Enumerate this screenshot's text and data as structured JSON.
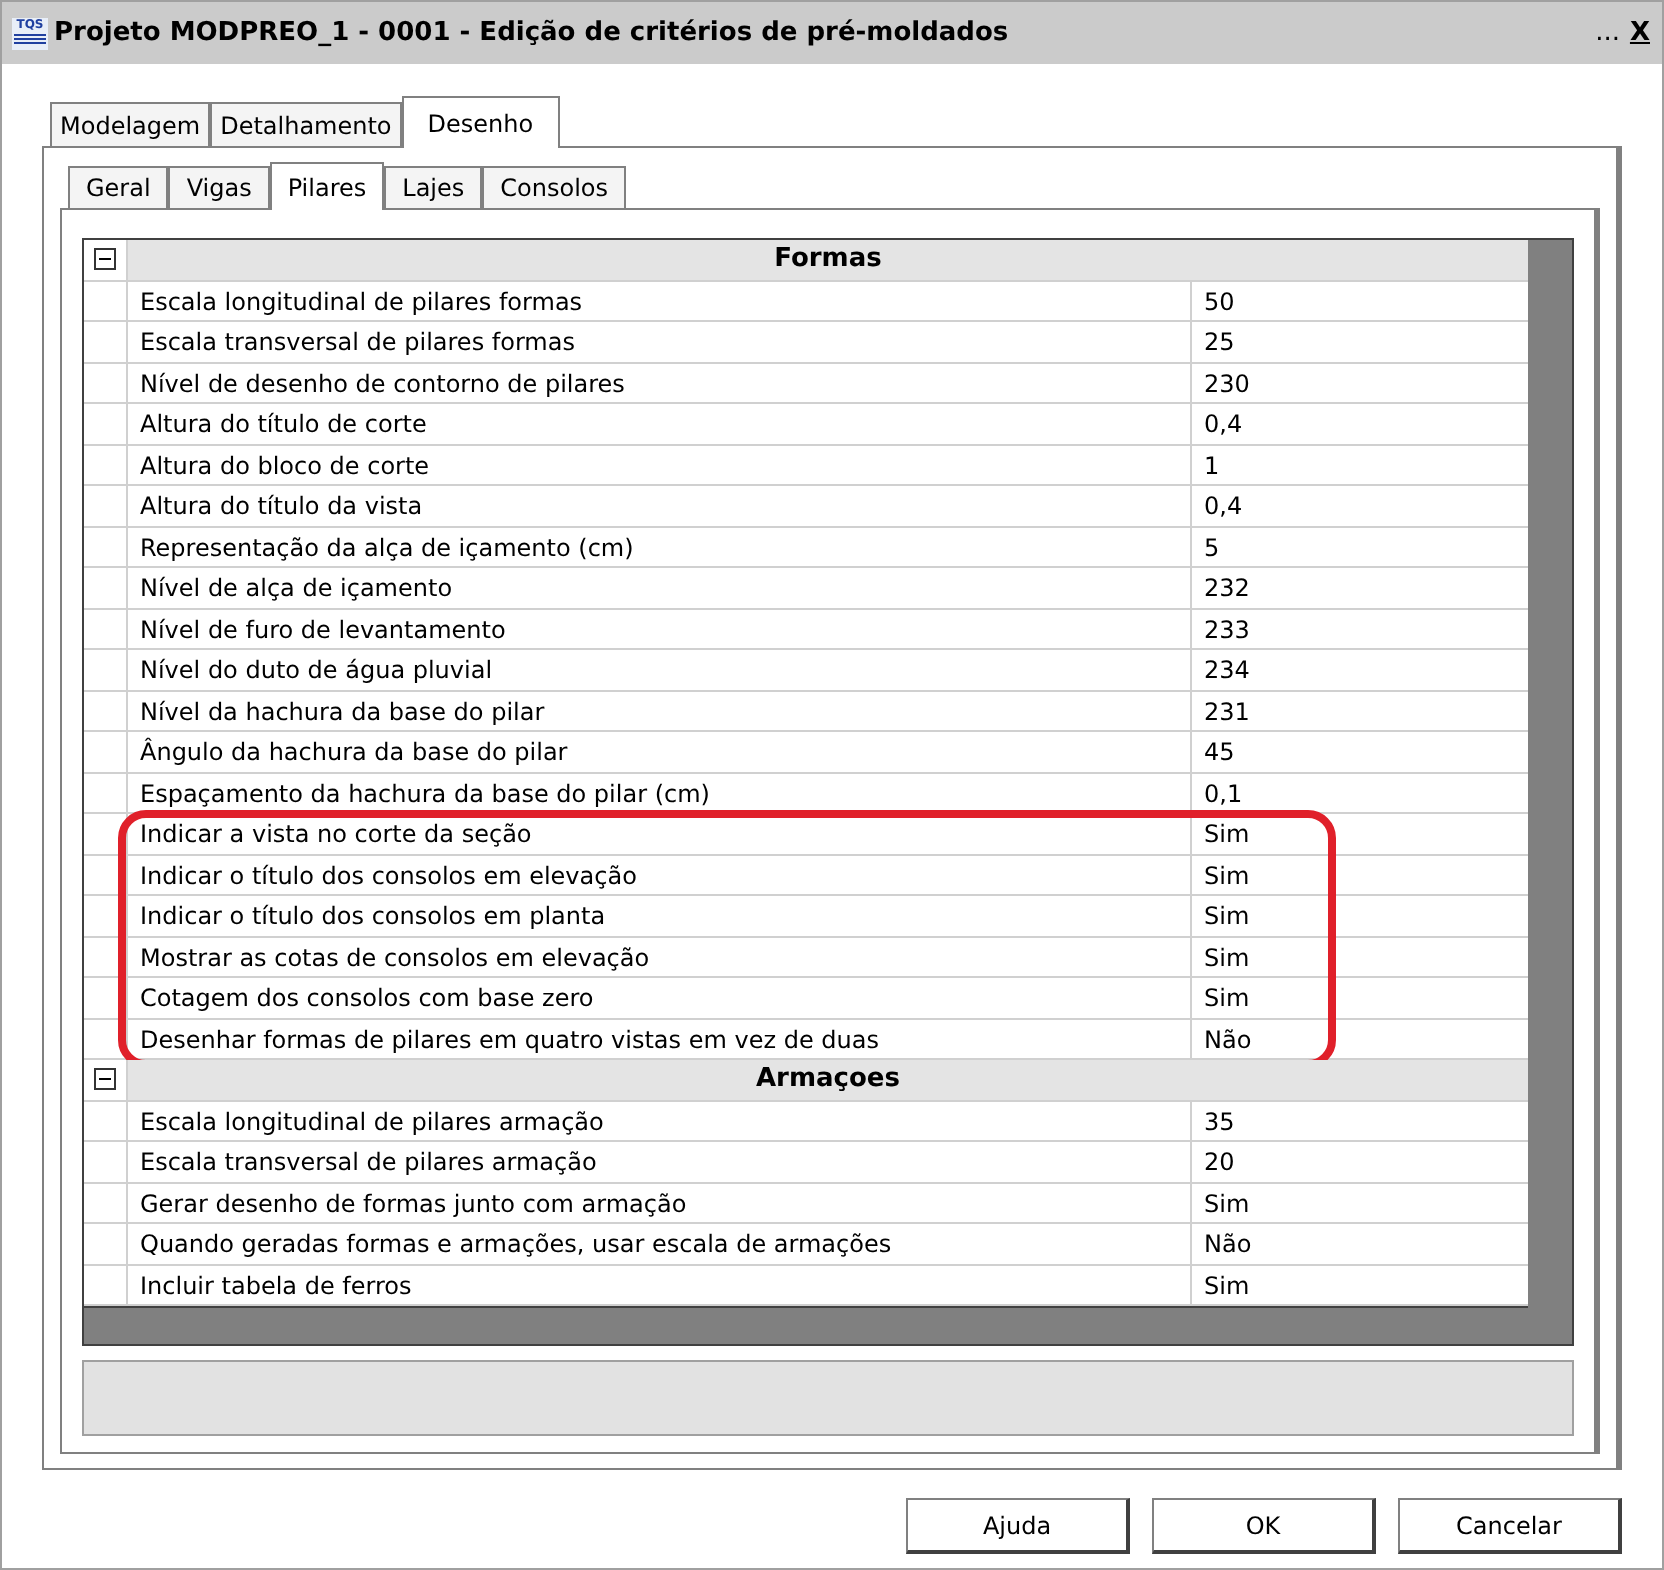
{
  "window": {
    "app_icon_text": "TQS",
    "title": "Projeto MODPREO_1 - 0001 - Edição de critérios de pré-moldados",
    "title_buttons": [
      "...",
      "X"
    ]
  },
  "tabs": [
    {
      "label": "Modelagem",
      "selected": false
    },
    {
      "label": "Detalhamento",
      "selected": false
    },
    {
      "label": "Desenho",
      "selected": true
    }
  ],
  "subtabs": [
    {
      "label": "Geral",
      "selected": false
    },
    {
      "label": "Vigas",
      "selected": false
    },
    {
      "label": "Pilares",
      "selected": true
    },
    {
      "label": "Lajes",
      "selected": false
    },
    {
      "label": "Consolos",
      "selected": false
    }
  ],
  "property_grid": {
    "sections": [
      {
        "title": "Formas",
        "expanded": true,
        "rows": [
          {
            "label": "Escala longitudinal de pilares formas",
            "value": "50",
            "highlighted": false
          },
          {
            "label": "Escala transversal  de pilares formas",
            "value": "25",
            "highlighted": false
          },
          {
            "label": "Nível de desenho de contorno de pilares",
            "value": "230",
            "highlighted": false
          },
          {
            "label": "Altura do título de corte",
            "value": "0,4",
            "highlighted": false
          },
          {
            "label": "Altura do bloco de corte",
            "value": "1",
            "highlighted": false
          },
          {
            "label": "Altura do título da vista",
            "value": "0,4",
            "highlighted": false
          },
          {
            "label": "Representação da alça de içamento (cm)",
            "value": "5",
            "highlighted": false
          },
          {
            "label": "Nível de alça de içamento",
            "value": "232",
            "highlighted": false
          },
          {
            "label": "Nível de furo de levantamento",
            "value": "233",
            "highlighted": false
          },
          {
            "label": "Nível do duto de água pluvial",
            "value": "234",
            "highlighted": false
          },
          {
            "label": "Nível  da hachura da base do pilar",
            "value": "231",
            "highlighted": false
          },
          {
            "label": "Ângulo da hachura da base do pilar",
            "value": "45",
            "highlighted": false
          },
          {
            "label": "Espaçamento da hachura da base do pilar (cm)",
            "value": "0,1",
            "highlighted": false
          },
          {
            "label": "Indicar a vista no corte da seção",
            "value": "Sim",
            "highlighted": true
          },
          {
            "label": "Indicar o título dos consolos em elevação",
            "value": "Sim",
            "highlighted": true
          },
          {
            "label": "Indicar o título dos consolos em planta",
            "value": "Sim",
            "highlighted": true
          },
          {
            "label": "Mostrar as cotas de consolos em elevação",
            "value": "Sim",
            "highlighted": true
          },
          {
            "label": "Cotagem dos consolos com base zero",
            "value": "Sim",
            "highlighted": true
          },
          {
            "label": "Desenhar formas de pilares em quatro vistas em vez de duas",
            "value": "Não",
            "highlighted": true
          }
        ]
      },
      {
        "title": "Armaçoes",
        "expanded": true,
        "rows": [
          {
            "label": "Escala longitudinal de pilares armação",
            "value": "35",
            "highlighted": false
          },
          {
            "label": "Escala transversal  de pilares armação",
            "value": "20",
            "highlighted": false
          },
          {
            "label": "Gerar desenho de formas junto com armação",
            "value": "Sim",
            "highlighted": false
          },
          {
            "label": "Quando geradas formas e armações, usar escala de armações",
            "value": "Não",
            "highlighted": false
          },
          {
            "label": "Incluir tabela de ferros",
            "value": "Sim",
            "highlighted": false
          }
        ]
      }
    ]
  },
  "buttons": [
    {
      "label": "Ajuda"
    },
    {
      "label": "OK"
    },
    {
      "label": "Cancelar"
    }
  ]
}
